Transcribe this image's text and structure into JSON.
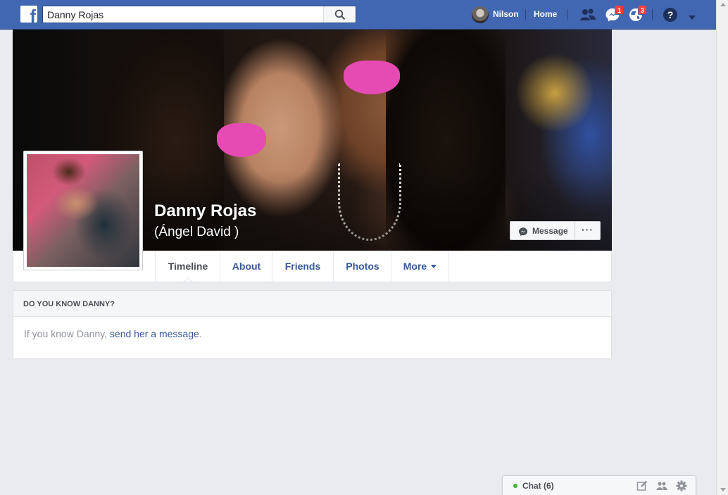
{
  "topbar": {
    "search_value": "Danny Rojas",
    "user_name": "Nilson",
    "home_label": "Home",
    "messages_badge": "1",
    "notifications_badge": "3",
    "brand_color": "#4267b2"
  },
  "profile": {
    "name": "Danny Rojas",
    "alternate_name": "(Ángel David )",
    "message_button": "Message",
    "more_button": "···"
  },
  "tabs": [
    {
      "label": "Timeline"
    },
    {
      "label": "About"
    },
    {
      "label": "Friends"
    },
    {
      "label": "Photos"
    },
    {
      "label": "More"
    }
  ],
  "know_card": {
    "title": "DO YOU KNOW DANNY?",
    "text_prefix": "If you know Danny, ",
    "link": "send her a message",
    "text_suffix": "."
  },
  "chat": {
    "label": "Chat (6)",
    "status_color": "#42b72a"
  },
  "icons": [
    "facebook-logo-icon",
    "search-icon",
    "friend-requests-icon",
    "messenger-icon",
    "globe-notifications-icon",
    "help-icon",
    "caret-down-icon",
    "compose-icon",
    "group-icon",
    "gear-icon"
  ]
}
